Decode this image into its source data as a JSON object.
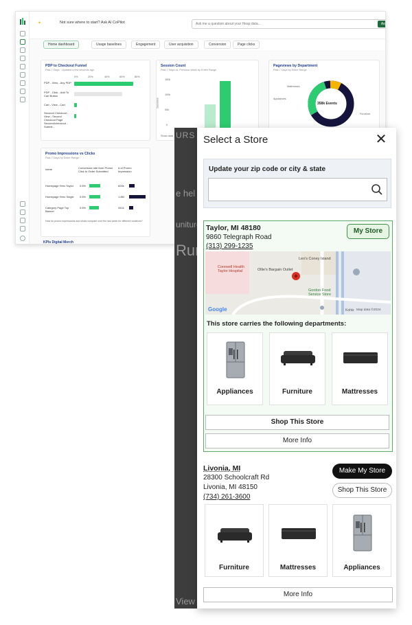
{
  "dashboard": {
    "ai_prompt": "Not sure where to start? Ask AI CoPilot",
    "ask_placeholder": "Ask me a question about your Heap data...",
    "ask_button": "Ask",
    "tabs": [
      "Home dashboard",
      "Usage baselines",
      "Engagement",
      "User acquisition",
      "Conversion",
      "Page clicks"
    ],
    "funnel": {
      "title": "PDP to Checkout Funnel",
      "subtitle": "Past 7 Days · Updated a few seconds ago",
      "ticks": [
        "0%",
        "20%",
        "40%",
        "60%",
        "80%"
      ],
      "steps": [
        {
          "label": "PDP - View - Any PDP",
          "value": 0.8
        },
        {
          "label": "PDP - Click - Add To Cart Button",
          "value": 0.05
        },
        {
          "label": "Cart - View - Cart",
          "value": 0.03
        },
        {
          "label": "Secured Checkout - View - Second Checkout Page Secured/checkout - Submit - Secured/checkout",
          "value": 0.02
        }
      ]
    },
    "session": {
      "title": "Session Count",
      "subtitle": "Past 7 Days vs. Previous Week by Entire Range",
      "yticks": [
        "150k",
        "100k",
        "50k",
        "0"
      ],
      "ylabel": "Sessions",
      "footer": "Show data",
      "values": [
        0.55,
        0.92
      ]
    },
    "pageviews": {
      "title": "Pageviews by Department",
      "subtitle": "Past 7 Days by Entire Range",
      "center": "358k Events",
      "labels": [
        "Mattresses",
        "Appliances",
        "Furniture"
      ]
    },
    "promo": {
      "title": "Promo Impressions vs Clicks",
      "subtitle": "Past 7 Days by Entire Range",
      "headers": [
        "name",
        "Conversion rate from Promo Click to Order Submitted",
        "# of Promo Impression"
      ],
      "rows": [
        {
          "name": "Homepage Hero Taylor",
          "rate": "0.6%",
          "impressions": "600k"
        },
        {
          "name": "Homepage Hero Single",
          "rate": "0.6%",
          "impressions": "1.8M"
        },
        {
          "name": "Category Page Top Banner",
          "rate": "0.6%",
          "impressions": "341k"
        }
      ],
      "footnote": "How do promo impressions and clicks compare over the last week for different creatives?"
    },
    "kpi_title": "KPIs Digital Merch"
  },
  "background_site": {
    "frag1": "URS",
    "frag2": "e hel",
    "frag3": "uniture",
    "frag4": "Run",
    "frag5": "View"
  },
  "panel": {
    "title": "Select a Store",
    "zip_label": "Update your zip code or city & state",
    "zip_value": "",
    "store1": {
      "name": "Taylor, MI 48180",
      "street": "9860 Telegraph Road",
      "phone": "(313) 299-1235",
      "badge": "My Store",
      "map": {
        "place1": "Corewell Health Taylor Hospital",
        "place2": "Ollie's Bargain Outlet",
        "place3": "Leo's Coney Island",
        "place4": "Gordon Food Service Store",
        "place5": "Kohls",
        "attribution": "Map data ©2024",
        "brand": "Google"
      },
      "dept_heading": "This store carries the following departments:",
      "departments": [
        "Appliances",
        "Furniture",
        "Mattresses"
      ],
      "shop_button": "Shop This Store",
      "more_button": "More Info"
    },
    "store2": {
      "name": "Livonia, MI",
      "street": "28300 Schoolcraft Rd",
      "city": "Livonia, MI 48150",
      "phone": "(734) 261-3600",
      "make_button": "Make My Store",
      "shop_button": "Shop This Store",
      "departments": [
        "Furniture",
        "Mattresses",
        "Appliances"
      ],
      "more_button": "More Info"
    }
  },
  "colors": {
    "accent_green": "#3e8e46",
    "dash_green": "#2ecc71",
    "navy": "#14143c",
    "amber": "#f4b400"
  }
}
